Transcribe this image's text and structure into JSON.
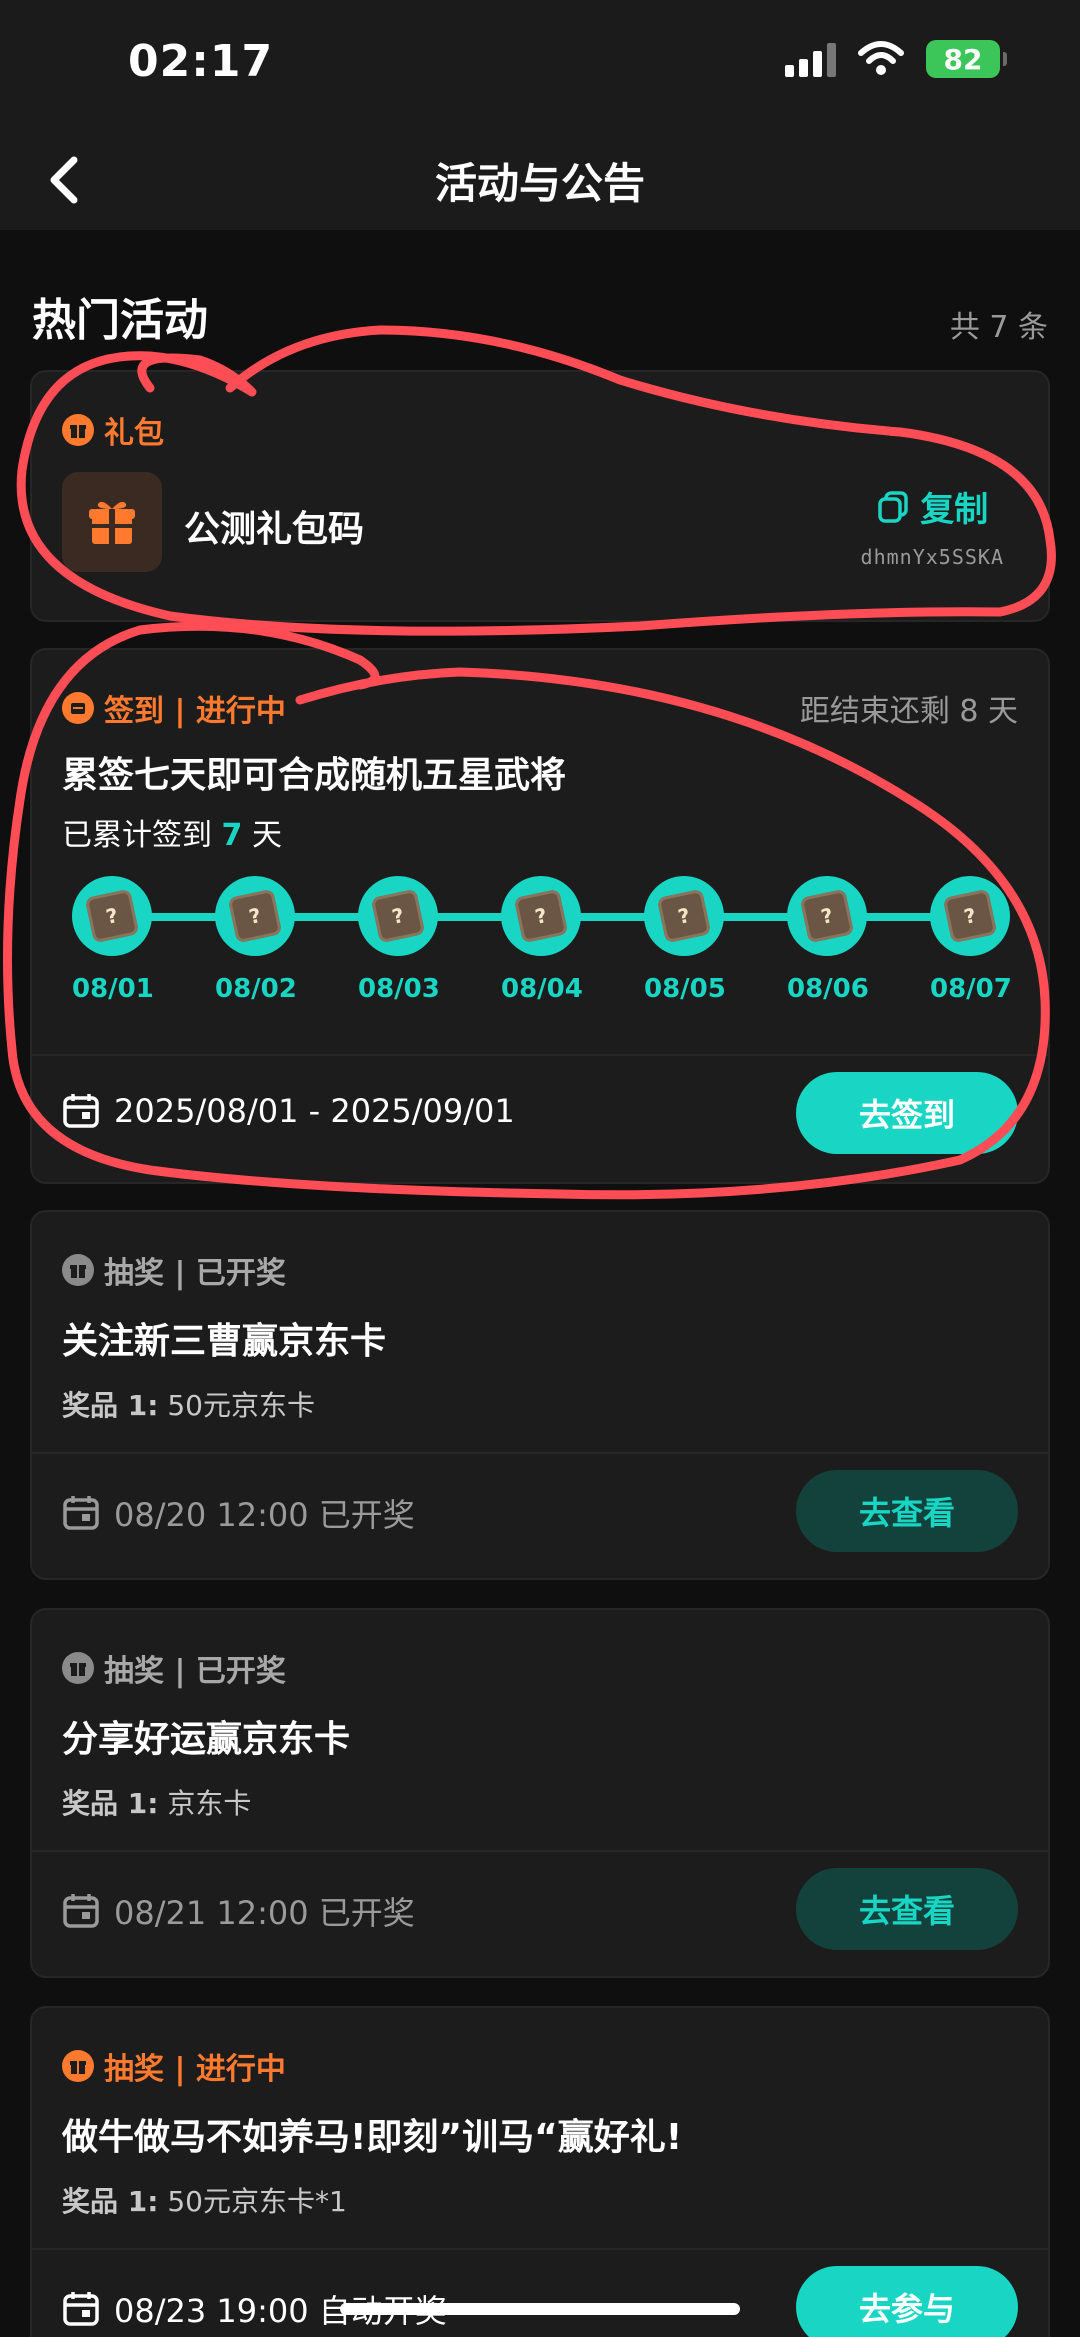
{
  "status_bar": {
    "time": "02:17",
    "battery": "82"
  },
  "header": {
    "title": "活动与公告"
  },
  "section": {
    "title": "热门活动",
    "count": "共 7 条"
  },
  "gift_card": {
    "tag": "礼包",
    "title": "公测礼包码",
    "copy_label": "复制",
    "code": "dhmnYx5SSKA"
  },
  "signin_card": {
    "tag": "签到 | 进行中",
    "remaining": "距结束还剩 8 天",
    "title": "累签七天即可合成随机五星武将",
    "signed_prefix": "已累计签到 ",
    "signed_days": "7",
    "signed_suffix": " 天",
    "days": [
      "08/01",
      "08/02",
      "08/03",
      "08/04",
      "08/05",
      "08/06",
      "08/07"
    ],
    "date_range": "2025/08/01 - 2025/09/01",
    "button": "去签到"
  },
  "lottery_cards": [
    {
      "tag": "抽奖 | 已开奖",
      "title": "关注新三曹赢京东卡",
      "prize_label": "奖品 1:",
      "prize_value": "50元京东卡",
      "date": "08/20 12:00 已开奖",
      "button": "去查看"
    },
    {
      "tag": "抽奖 | 已开奖",
      "title": "分享好运赢京东卡",
      "prize_label": "奖品 1:",
      "prize_value": "京东卡",
      "date": "08/21 12:00 已开奖",
      "button": "去查看"
    },
    {
      "tag": "抽奖 | 进行中",
      "title": "做牛做马不如养马!即刻”训马“赢好礼!",
      "prize_label": "奖品 1:",
      "prize_value": "50元京东卡*1",
      "date": "08/23 19:00 自动开奖",
      "button": "去参与"
    }
  ],
  "colors": {
    "accent": "#19d6c4",
    "orange": "#ff7a2e",
    "annotation": "#ff4d55"
  },
  "icons": [
    "chevron-left-icon",
    "gift-icon",
    "copy-icon",
    "calendar-icon",
    "signal-icon",
    "wifi-icon",
    "battery-icon",
    "puzzle-piece-icon"
  ]
}
